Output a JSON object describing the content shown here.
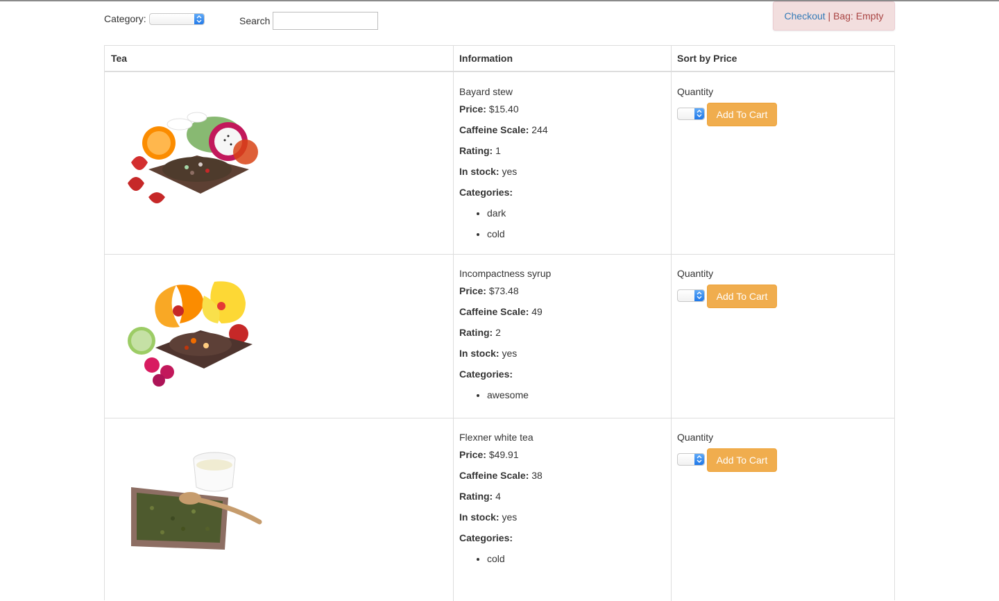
{
  "filters": {
    "category_label": "Category:",
    "category_value": "",
    "search_label": "Search",
    "search_value": "",
    "search_placeholder": ""
  },
  "cart": {
    "checkout_label": "Checkout",
    "separator": " | ",
    "bag_text": "Bag: Empty"
  },
  "table": {
    "headers": [
      "Tea",
      "Information",
      "Sort by Price"
    ],
    "field_labels": {
      "price": "Price:",
      "caffeine": "Caffeine Scale:",
      "rating": "Rating:",
      "stock": "In stock:",
      "categories": "Categories:"
    },
    "quantity_label": "Quantity",
    "add_to_cart_label": "Add To Cart",
    "rows": [
      {
        "name": "Bayard stew",
        "price": "$15.40",
        "caffeine": "244",
        "rating": "1",
        "stock": "yes",
        "categories": [
          "dark",
          "cold"
        ],
        "image": "fruit-tea-icon"
      },
      {
        "name": "Incompactness syrup",
        "price": "$73.48",
        "caffeine": "49",
        "rating": "2",
        "stock": "yes",
        "categories": [
          "awesome"
        ],
        "image": "hibiscus-tea-icon"
      },
      {
        "name": "Flexner white tea",
        "price": "$49.91",
        "caffeine": "38",
        "rating": "4",
        "stock": "yes",
        "categories": [
          "cold"
        ],
        "image": "green-tea-icon"
      }
    ]
  },
  "colors": {
    "accent_button": "#f0ad4e",
    "alert_bg": "#f2dede",
    "alert_text": "#a94442",
    "link": "#337ab7"
  }
}
